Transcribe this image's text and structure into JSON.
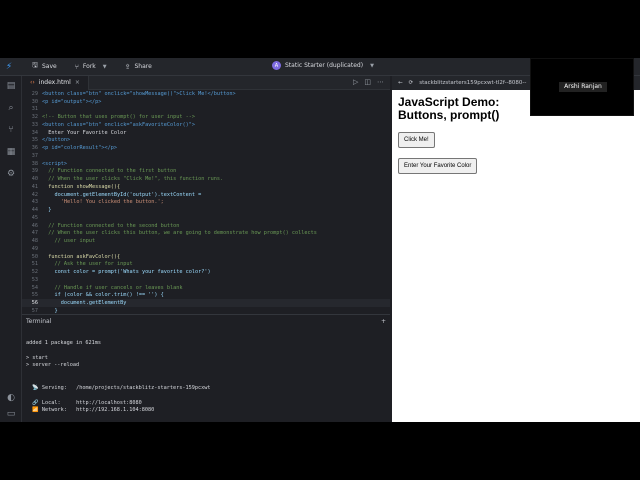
{
  "toolbar": {
    "save_label": "Save",
    "fork_label": "Fork",
    "share_label": "Share",
    "project_avatar": "A",
    "project_name": "Static Starter (duplicated)"
  },
  "editor": {
    "tab_label": "index.html",
    "code_lines": [
      {
        "no": "29",
        "text": "<button class=\"btn\" onclick=\"showMessage()\">Click Me!</button>"
      },
      {
        "no": "30",
        "text": "<p id=\"output\"></p>"
      },
      {
        "no": "31",
        "text": ""
      },
      {
        "no": "32",
        "text": "<!-- Button that uses prompt() for user input -->"
      },
      {
        "no": "33",
        "text": "<button class=\"btn\" onclick=\"askFavoriteColor()\">"
      },
      {
        "no": "34",
        "text": "  Enter Your Favorite Color"
      },
      {
        "no": "35",
        "text": "</button>"
      },
      {
        "no": "36",
        "text": "<p id=\"colorResult\"></p>"
      },
      {
        "no": "37",
        "text": ""
      },
      {
        "no": "38",
        "text": "<script>"
      },
      {
        "no": "39",
        "text": "  // Function connected to the first button"
      },
      {
        "no": "40",
        "text": "  // When the user clicks \"Click Me!\", this function runs."
      },
      {
        "no": "41",
        "text": "  function showMessage(){"
      },
      {
        "no": "42",
        "text": "    document.getElementById('output').textContent ="
      },
      {
        "no": "43",
        "text": "      'Hello! You clicked the button.';"
      },
      {
        "no": "44",
        "text": "  }"
      },
      {
        "no": "45",
        "text": ""
      },
      {
        "no": "46",
        "text": "  // Function connected to the second button"
      },
      {
        "no": "47",
        "text": "  // When the user clicks this button, we are going to demonstrate how prompt() collects"
      },
      {
        "no": "48",
        "text": "    // user input"
      },
      {
        "no": "49",
        "text": ""
      },
      {
        "no": "50",
        "text": "  function askFavColor(){"
      },
      {
        "no": "51",
        "text": "    // Ask the user for input"
      },
      {
        "no": "52",
        "text": "    const color = prompt('Whats your favorite color?')"
      },
      {
        "no": "53",
        "text": ""
      },
      {
        "no": "54",
        "text": "    // Handle if user cancels or leaves blank"
      },
      {
        "no": "55",
        "text": "    if (color && color.trim() !== '') {"
      },
      {
        "no": "56",
        "text": "      document.getElementBy"
      },
      {
        "no": "57",
        "text": "    }"
      }
    ]
  },
  "terminal": {
    "title": "Terminal",
    "lines": [
      "",
      "added 1 package in 621ms",
      "",
      "> start",
      "> server --reload",
      "",
      "",
      "  📡 Serving:   /home/projects/stackblitz-starters-159pcxwt",
      "",
      "  🔗 Local:     http://localhost:8080",
      "  📶 Network:   http://192.168.1.104:8080"
    ]
  },
  "preview": {
    "url": "stackblitzstarters159pcxwt-tl2f--8080--",
    "title": "JavaScript Demo: Buttons, prompt()",
    "button1": "Click Me!",
    "button2": "Enter Your Favorite Color"
  },
  "webcam": {
    "name": "Arshi Ranjan"
  },
  "colors": {
    "accent": "#3fa1ff",
    "editor_bg": "#1e1f24",
    "preview_bg": "#ffffff"
  }
}
